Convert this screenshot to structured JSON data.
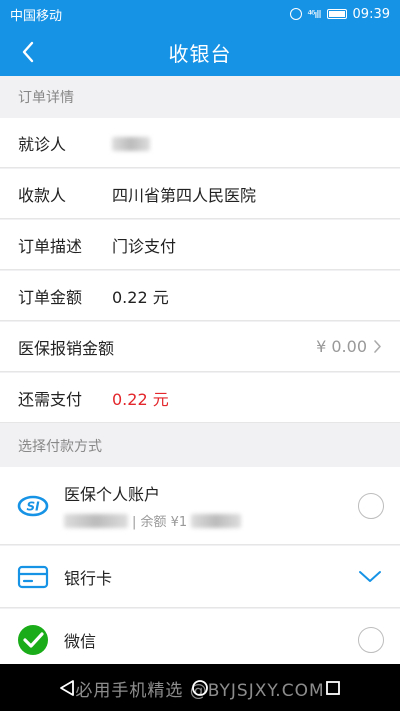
{
  "status_bar": {
    "carrier": "中国移动",
    "signal": "⁴⁶ıll",
    "time": "09:39"
  },
  "nav": {
    "title": "收银台"
  },
  "order_section": {
    "header": "订单详情"
  },
  "order_rows": [
    {
      "label": "就诊人",
      "value": ""
    },
    {
      "label": "收款人",
      "value": "四川省第四人民医院"
    },
    {
      "label": "订单描述",
      "value": "门诊支付"
    },
    {
      "label": "订单金额",
      "value": "0.22 元"
    },
    {
      "label": "医保报销金额",
      "value": "¥ 0.00"
    },
    {
      "label": "还需支付",
      "value": "0.22 元"
    }
  ],
  "payment_section": {
    "header": "选择付款方式"
  },
  "payment_methods": [
    {
      "name": "医保个人账户",
      "balance_label": "| 余额 ¥1"
    },
    {
      "name": "银行卡"
    },
    {
      "name": "微信"
    }
  ],
  "watermark": "必用手机精选 @BYJSJXY.COM",
  "colors": {
    "primary": "#1793e6",
    "alert": "#e3262b",
    "wechat": "#1aad19"
  }
}
